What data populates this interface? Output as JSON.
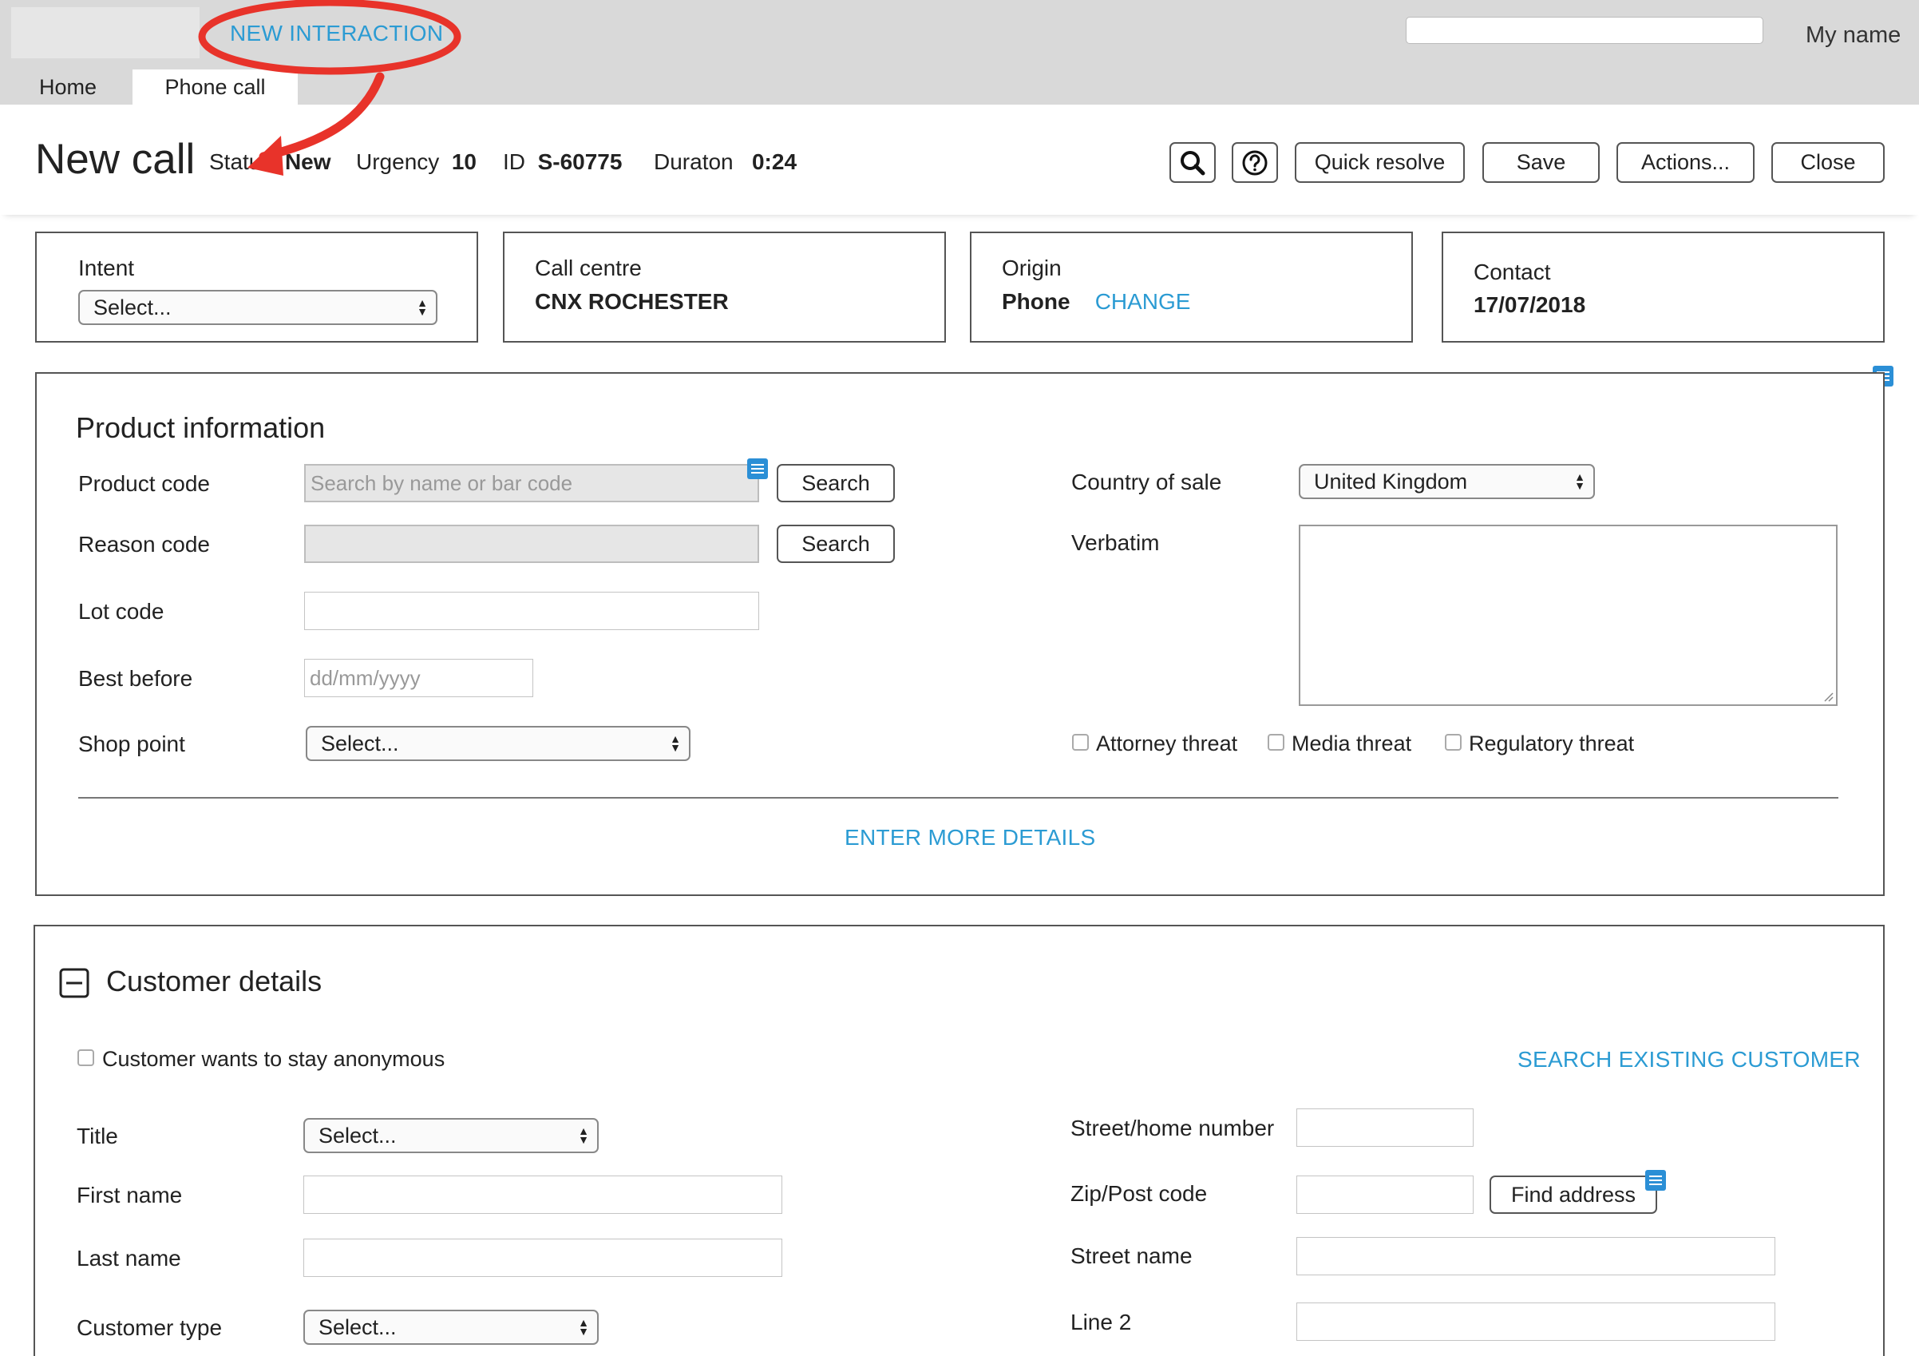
{
  "topbar": {
    "new_interaction": "NEW INTERACTION",
    "user_name": "My name",
    "search_value": ""
  },
  "tabs": [
    {
      "label": "Home",
      "active": false
    },
    {
      "label": "Phone call",
      "active": true
    }
  ],
  "header": {
    "title": "New call",
    "status_label": "Status",
    "status_value": "New",
    "urgency_label": "Urgency",
    "urgency_value": "10",
    "id_label": "ID",
    "id_value": "S-60775",
    "duration_label": "Duraton",
    "duration_value": "0:24",
    "buttons": {
      "quick_resolve": "Quick resolve",
      "save": "Save",
      "actions": "Actions...",
      "close": "Close"
    }
  },
  "cards": {
    "intent": {
      "label": "Intent",
      "select": "Select..."
    },
    "call_centre": {
      "label": "Call centre",
      "value": "CNX ROCHESTER"
    },
    "origin": {
      "label": "Origin",
      "value": "Phone",
      "link": "CHANGE"
    },
    "contact": {
      "label": "Contact",
      "value": "17/07/2018"
    }
  },
  "product": {
    "title": "Product information",
    "product_code_label": "Product code",
    "product_code_placeholder": "Search by name or bar code",
    "reason_code_label": "Reason code",
    "lot_code_label": "Lot code",
    "best_before_label": "Best before",
    "best_before_placeholder": "dd/mm/yyyy",
    "shop_point_label": "Shop point",
    "shop_point_select": "Select...",
    "search_label": "Search",
    "country_label": "Country of sale",
    "country_value": "United Kingdom",
    "verbatim_label": "Verbatim",
    "threats": [
      "Attorney threat",
      "Media threat",
      "Regulatory threat"
    ],
    "more_details": "ENTER MORE DETAILS"
  },
  "customer": {
    "title": "Customer details",
    "anonymous_label": "Customer wants to stay anonymous",
    "search_existing": "SEARCH EXISTING CUSTOMER",
    "title_label": "Title",
    "title_select": "Select...",
    "first_name_label": "First name",
    "last_name_label": "Last name",
    "customer_type_label": "Customer type",
    "customer_type_select": "Select...",
    "street_home_label": "Street/home number",
    "zip_label": "Zip/Post code",
    "find_address": "Find address",
    "street_name_label": "Street name",
    "line2_label": "Line 2"
  },
  "colors": {
    "accent_link": "#2b9bd3",
    "annotation_red": "#e8332a",
    "note_icon_blue": "#2b8fd6",
    "topbar_grey": "#d9d9d9"
  }
}
